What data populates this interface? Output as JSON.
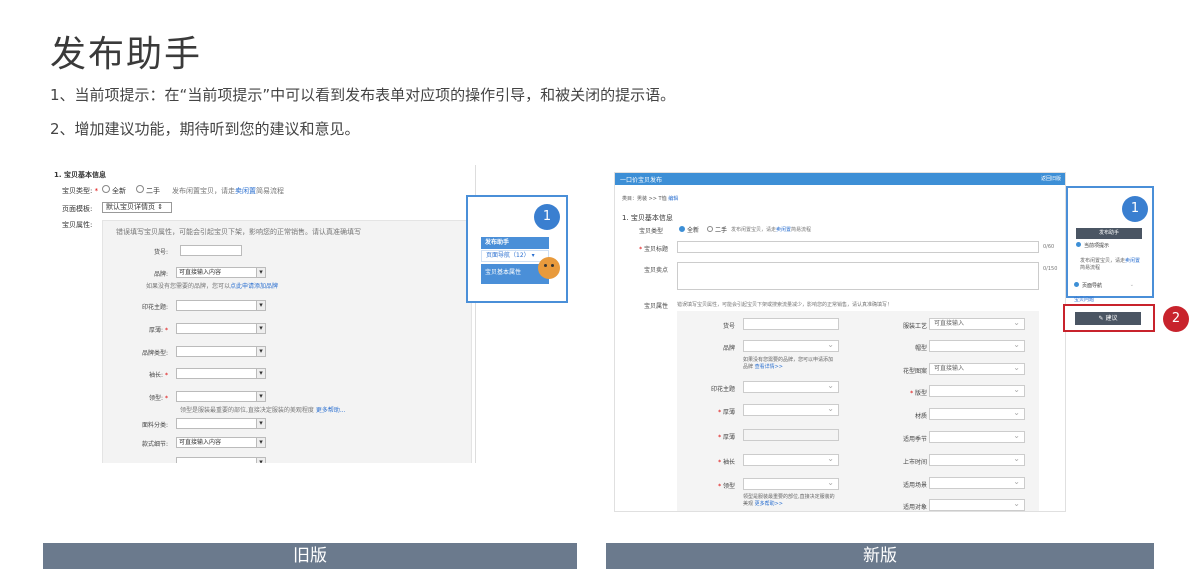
{
  "title": "发布助手",
  "desc1": "1、当前项提示：在“当前项提示”中可以看到发布表单对应项的操作引导，和被关闭的提示语。",
  "desc2": "2、增加建议功能，期待听到您的建议和意见。",
  "old": {
    "section_title": "1. 宝贝基本信息",
    "type_label": "宝贝类型:",
    "type_req": "*",
    "type_new": "全新",
    "type_used": "二手",
    "type_hint": "发布闲置宝贝，请走",
    "type_hint_link": "卖闲置",
    "type_hint_tail": "简易流程",
    "template_label": "页面模板:",
    "template_value": "默认宝贝详情页",
    "template_arrow": "⇕",
    "attr_label": "宝贝属性:",
    "attr_hint": "错误填写宝贝属性，可能会引起宝贝下架，影响您的正常销售。请认真准确填写",
    "huohao": "货号:",
    "brand": "品牌:",
    "brand_value": "可直接输入内容",
    "brand_hint": "如果没有您需要的品牌，您可以",
    "brand_hint_link": "点此申请添加品牌",
    "yinhua": "印花主题:",
    "houbo": "厚薄:",
    "pinpai_type": "品牌类型:",
    "xiuchang": "袖长:",
    "lingxing": "领型:",
    "lingxing_hint": "领型是服装最重要的部位,直接决定服装的美观程度",
    "lingxing_link": "更多帮助...",
    "mianliao": "面料分类:",
    "kuanshi": "款式细节:",
    "kuanshi_value": "可直接输入内容",
    "assist_number": "1",
    "assist_header": "发布助手",
    "assist_nav": "页面导航（12）",
    "assist_nav_arrow": "▾",
    "assist_item": "宝贝基本属性",
    "bar_label": "旧版"
  },
  "new": {
    "topbar_title": "一口价宝贝发布",
    "topbar_right": "返回旧版",
    "crumb": "类目：男装 >> T恤",
    "crumb_link": "编辑",
    "section_title": "1. 宝贝基本信息",
    "type_label": "宝贝类型",
    "type_new": "全新",
    "type_used": "二手",
    "type_hint": "发布闲置宝贝，请走",
    "type_hint_link": "卖闲置",
    "type_hint_tail": "简易流程",
    "title_label": "宝贝标题",
    "title_req": "*",
    "title_count": "0/60",
    "points_label": "宝贝卖点",
    "points_count": "0/150",
    "attr_label": "宝贝属性",
    "attr_hint": "错误填写宝贝属性，可能会引起宝贝下架或搜索流量减少，影响您的正常销售，请认真准确填写！",
    "left_fields": [
      {
        "label": "货号",
        "req": ""
      },
      {
        "label": "品牌",
        "req": ""
      },
      {
        "label": "印花主题",
        "req": ""
      },
      {
        "label": "厚薄",
        "req": "*"
      },
      {
        "label": "厚薄",
        "req": "*"
      },
      {
        "label": "袖长",
        "req": "*"
      },
      {
        "label": "领型",
        "req": "*"
      }
    ],
    "brand_hint": "如果没有您需要的品牌，您可以申请添加品牌",
    "brand_link": "查看详情>>",
    "lingxing_hint": "领型是服装最重要的部位,直接决定服装的美观",
    "lingxing_link": "更多帮助>>",
    "right_fields": [
      {
        "label": "服装工艺",
        "req": "",
        "value": "可直接输入"
      },
      {
        "label": "帽型",
        "req": "",
        "value": ""
      },
      {
        "label": "花型图案",
        "req": "",
        "value": "可直接输入"
      },
      {
        "label": "版型",
        "req": "*",
        "value": ""
      },
      {
        "label": "材质",
        "req": "",
        "value": ""
      },
      {
        "label": "适用季节",
        "req": "",
        "value": ""
      },
      {
        "label": "上市时间",
        "req": "",
        "value": ""
      },
      {
        "label": "适用场景",
        "req": "",
        "value": ""
      },
      {
        "label": "适用对象",
        "req": "",
        "value": ""
      }
    ],
    "assist_number": "1",
    "assist_header": "发布助手",
    "assist_current": "当前项提示",
    "assist_tip": "发布闲置宝贝，请走",
    "assist_tip_link": "卖闲置",
    "assist_tip_tail": "简易流程",
    "assist_nav": "页面导航",
    "assist_cut": "宝贝问题",
    "suggest_label": "建议",
    "suggest_icon": "✎",
    "number2": "2",
    "bar_label": "新版"
  }
}
